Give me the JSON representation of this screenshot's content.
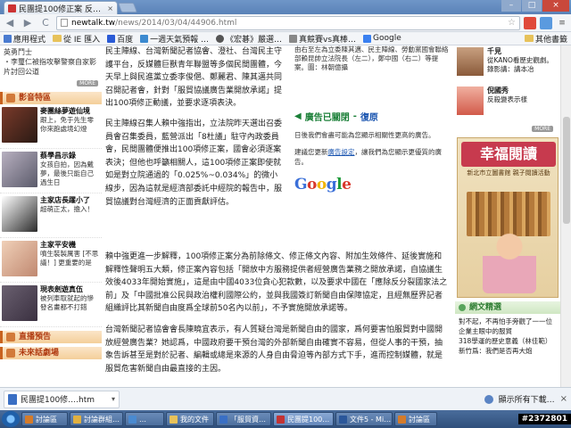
{
  "browser": {
    "tab_title": "民團提100修正案 反…",
    "tab_close": "×",
    "url_domain": "newtalk.tw",
    "url_path": "/news/2014/03/04/44906.html",
    "window_buttons": [
      "–",
      "□",
      "×"
    ],
    "back_label": "◀",
    "forward_label": "▶",
    "reload_label": "C",
    "star_label": "☆",
    "menu_label": "≡"
  },
  "bookmarks": {
    "items": [
      {
        "label": "應用程式",
        "color": "#4a7bd0"
      },
      {
        "label": "從 IE 匯入",
        "color": "#e7c25a"
      },
      {
        "label": "百度",
        "color": "#2b5bd6"
      },
      {
        "label": "一週天氣預報 …",
        "color": "#3c8ad0"
      },
      {
        "label": "《宏碁》嚴選…",
        "color": "#555555"
      },
      {
        "label": "真競賽vs真棒…",
        "color": "#888888"
      },
      {
        "label": "Google",
        "color": "#3a80f0"
      }
    ],
    "other": "其他書籤"
  },
  "left": {
    "top_text": "英勇鬥士\n・李璽仁被指攻擊警察自家影片討回公道",
    "more": "MORE",
    "section_title": "影音特區",
    "items": [
      {
        "title": "麥團絲夢遊仙境",
        "desc": "跟上，免于先生零你來跑處境幻燈",
        "color": "#7a3a2a"
      },
      {
        "title": "蔡學昌示錄",
        "desc": "女孩自拍，因為戴夢，最後只能自己過生日",
        "color": "#5a5a6a"
      },
      {
        "title": "主家店長躍小了",
        "desc": "超萌正太，擔入！",
        "color": "#2a2a2a"
      },
      {
        "title": "主家平安機",
        "desc": "噴生裝製厲害 [不思議！] 更重要的是",
        "color": "#c08870"
      },
      {
        "title": "現表劍遊真伍",
        "desc": "被列車取就起的慘發名畫都不打錯",
        "color": "#3a3040"
      }
    ],
    "section2": "直播預告",
    "section3": "未來話劇場"
  },
  "article": {
    "p1": "民主陣線、台灣新聞記者協會、澄社、台灣民主守護平台，反媒體巨獸青年聯盟等多個民間團體，今天早上與民進黨立委李俊俋、鄭麗君、陳其邁共同召開記者會，針對「服貿協議廣告業開放承諾」提出100項修正動議，並要求逐項表決。",
    "p2": "民主陣線召集人賴中強指出，立法院昨天選出召委員會召集委員，藍營派出「8杜議」駐守內政委員會，民間團體便推出100項修正案，國會必須逐案表決；但他也呼籲相關人，這100項修正案即使就如是對立院通過的「0.025%~0.034%」的微小線步，因為這就是經濟部委託中經院的報告中，服貿協議對台灣經濟的正面貢獻評估。",
    "p3": "賴中強更進一步解釋，100項修正案分為前除條文、修正條文內容、附加生效條件、延後實施和解釋性聲明五大類，修正案內容包括「開放中方服務提供者經營廣告業務之開放承諾，自協議生效後4033年開始實施」，這是由中國4033位貪心犯款數，以及要求中國在「應除反分裂國家法之前」及「中國批准公民與政治權利國際公約，並與我國簽訂新聞自由保障協定，且經無歷界記者組織評比其新聞自由度爲全球前50名內以前」，不予實施開放承諾等。",
    "p4": "台灣新聞記者協會會長陳曉宜表示，有人質疑台灣是新聞自由的國家，爲何要害怕服貿對中國開放經營廣告業？她認爲，中國政府要干預台灣的外部新聞自由確實不容易，但從人事的干預，抽象告訴甚至是對於記者、編輯或總是來源的人身自由脅迫等內部方式下手，進而控制媒體，就是服貿危害新聞自由最直接的主因。"
  },
  "ad": {
    "caption": "由右至左為立委陳其邁、民主陣線、勞動黨國會聯絡部賴昆帥立法院長（左二），鄭中國（右二）等提案。圖：林朝億攝",
    "closed_label": "廣告已關閉",
    "undo_label": "復原",
    "note": "日後我們會盡可能為您顯示相關性更高的廣告。",
    "note2_pre": "建議您更新",
    "note2_link": "廣告設定",
    "note2_post": "，讓我們為您顯示更優質的廣告。",
    "google": "Google"
  },
  "right": {
    "items": [
      {
        "title": "千見",
        "desc": "從KANO看歷史觀劇。錄影講：講本冶",
        "color": "#8a5a3a"
      },
      {
        "title": "倪國秀",
        "desc": "反殺變表示樣",
        "color": "#d25a4a"
      }
    ],
    "more": "MORE",
    "banner_title": "幸福閱讀",
    "banner_sub": "新北市立圖書館 親子閱讀活動",
    "section": "網文精選",
    "list": [
      "對不起，不再怕手旁觀了一一位企業主眼中的服貿",
      "318學運的歷史意義（林佳範）",
      "新竹爲：我們是否再大炮"
    ]
  },
  "downloads": {
    "file": "民團提100修….htm",
    "caret": "▾",
    "show_all": "顯示所有下載…",
    "close": "×"
  },
  "taskbar": {
    "items": [
      {
        "label": "討論區",
        "color": "#d47b2a"
      },
      {
        "label": "討論群組…",
        "color": "#e0b040"
      },
      {
        "label": "…",
        "color": "#4a8ad0"
      },
      {
        "label": "我的文件",
        "color": "#e7c25a"
      },
      {
        "label": "「服貿資…",
        "color": "#3a6fc4"
      },
      {
        "label": "民團提100…",
        "color": "#c33333"
      },
      {
        "label": "文件5 - Mi…",
        "color": "#2b579a"
      },
      {
        "label": "討論區",
        "color": "#d47b2a"
      }
    ],
    "badge": "#2372801"
  }
}
